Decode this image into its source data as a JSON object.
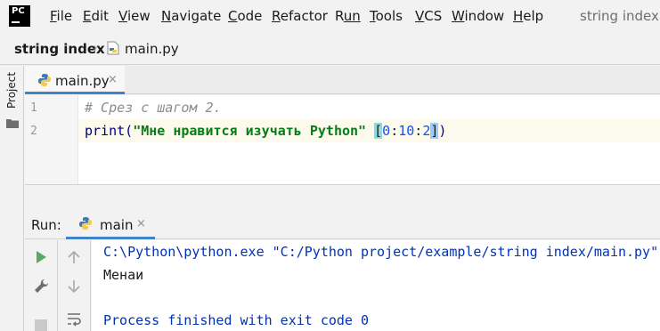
{
  "app": {
    "logo_text": "PC",
    "window_title": "string index -"
  },
  "menu": [
    {
      "label": "File",
      "mnemonic": "F",
      "rest": "ile"
    },
    {
      "label": "Edit",
      "mnemonic": "E",
      "rest": "dit"
    },
    {
      "label": "View",
      "mnemonic": "V",
      "rest": "iew"
    },
    {
      "label": "Navigate",
      "mnemonic": "N",
      "rest": "avigate"
    },
    {
      "label": "Code",
      "mnemonic": "C",
      "rest": "ode"
    },
    {
      "label": "Refactor",
      "mnemonic": "R",
      "rest": "efactor"
    },
    {
      "label": "Run",
      "mnemonic": "R",
      "rest": "un",
      "mnemonic_index": 1
    },
    {
      "label": "Tools",
      "mnemonic": "T",
      "rest": "ools"
    },
    {
      "label": "VCS",
      "mnemonic": "V",
      "rest": "CS",
      "mnemonic_index": 0
    },
    {
      "label": "Window",
      "mnemonic": "W",
      "rest": "indow"
    },
    {
      "label": "Help",
      "mnemonic": "H",
      "rest": "elp"
    }
  ],
  "breadcrumb": {
    "project": "string index",
    "file": "main.py"
  },
  "sidebar": {
    "project_label": "Project"
  },
  "editor": {
    "tab_label": "main.py",
    "tab_close": "×",
    "lines": [
      {
        "number": "1",
        "comment": "# Срез с шагом 2."
      },
      {
        "number": "2",
        "func": "print(",
        "string": "\"Мне нравится изучать Python\"",
        "space": " ",
        "open_bracket": "[",
        "n1": "0",
        "colon1": ":",
        "n2": "10",
        "colon2": ":",
        "n3": "2",
        "close_bracket": "]",
        "close_paren": ")"
      }
    ]
  },
  "run_panel": {
    "title": "Run:",
    "tab_label": "main",
    "tab_close": "×",
    "console": {
      "command": "C:\\Python\\python.exe \"C:/Python project/example/string index/main.py\"",
      "output": "Менаи",
      "exit_message": "Process finished with exit code 0"
    }
  },
  "colors": {
    "accent": "#4083c9",
    "comment": "#8c8c8c",
    "string": "#067d17",
    "number": "#1750eb",
    "console_system": "#0033b3",
    "run_green": "#59a869"
  },
  "icons": [
    "pycharm-logo-icon",
    "python-file-icon",
    "folder-icon",
    "run-icon",
    "wrench-icon",
    "stop-icon",
    "arrow-up-icon",
    "arrow-down-icon",
    "soft-wrap-icon"
  ]
}
